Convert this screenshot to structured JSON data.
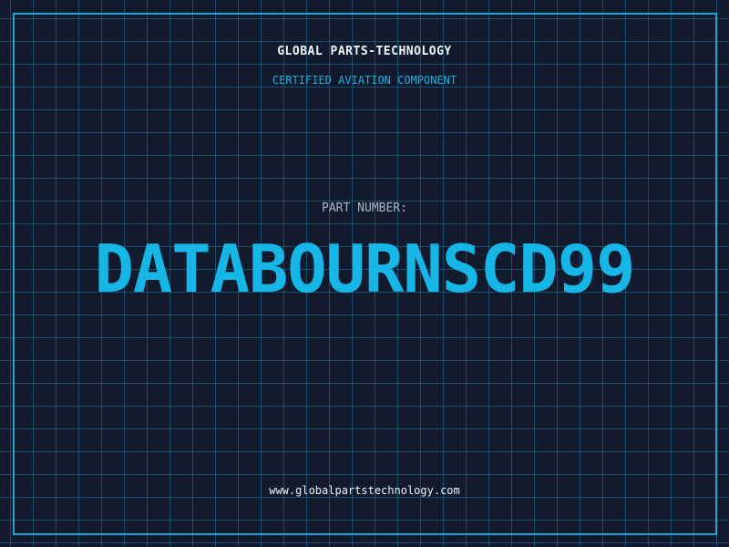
{
  "brand": {
    "title": "GLOBAL PARTS-TECHNOLOGY",
    "subtitle": "CERTIFIED AVIATION COMPONENT"
  },
  "part": {
    "label": "PART NUMBER:",
    "number": "DATABOURNSCD99"
  },
  "footer": {
    "website": "www.globalpartstechnology.com"
  },
  "colors": {
    "background": "#121a2e",
    "grid": "#1e78a0",
    "accent": "#16b6e6",
    "frame": "#1fa6d0"
  }
}
